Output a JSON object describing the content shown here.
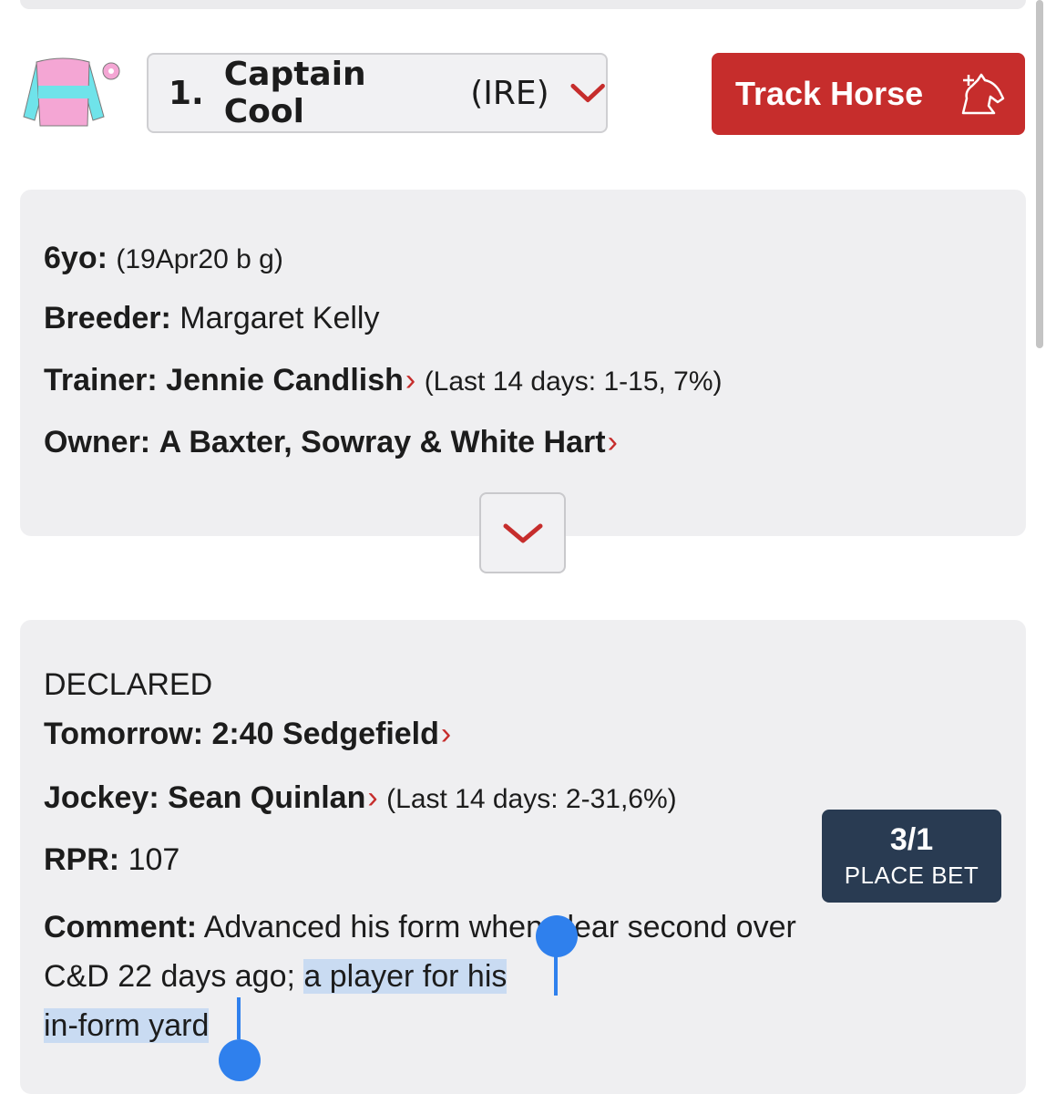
{
  "header": {
    "horse_number": "1.",
    "horse_name": "Captain Cool",
    "horse_country": "(IRE)",
    "track_button_label": "Track Horse",
    "colors": {
      "accent_red": "#c62d2c",
      "odds_navy": "#293b52",
      "panel_bg": "#efeff1",
      "selection_blue": "#2f80ed"
    }
  },
  "details": {
    "age_label": "6yo:",
    "age_value": "(19Apr20 b g)",
    "breeder_label": "Breeder:",
    "breeder_value": "Margaret Kelly",
    "trainer_label": "Trainer:",
    "trainer_name": "Jennie Candlish",
    "trainer_stats": "(Last 14 days: 1-15, 7%)",
    "owner_label": "Owner:",
    "owner_name": "A Baxter, Sowray & White Hart"
  },
  "race": {
    "status": "DECLARED",
    "day_label": "Tomorrow:",
    "race_name": "2:40 Sedgefield",
    "jockey_label": "Jockey:",
    "jockey_name": "Sean Quinlan",
    "jockey_stats": "(Last 14 days: 2-31,6%)",
    "rpr_label": "RPR:",
    "rpr_value": "107",
    "comment_label": "Comment:",
    "comment_text_plain": "Advanced his form when clear second over C&D 22 days ago;",
    "comment_text_selected_1": "a player for his",
    "comment_text_selected_2": "in-form yard",
    "odds": "3/1",
    "bet_label": "PLACE BET"
  },
  "icons": {
    "silks": "jockey-silks-icon",
    "dropdown": "chevron-down-icon",
    "track": "horse-head-plus-icon",
    "expand": "chevron-down-icon",
    "link_arrow": "chevron-right-icon"
  }
}
